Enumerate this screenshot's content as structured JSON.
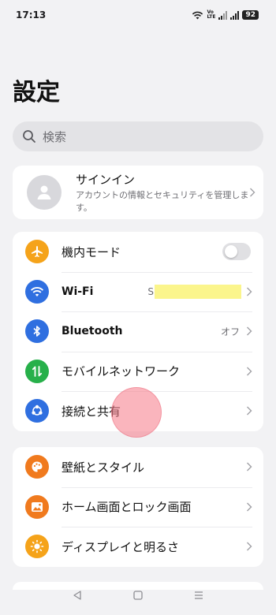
{
  "status_bar": {
    "time": "17:13",
    "volte_top": "Vo",
    "volte_bottom": "LTE",
    "battery": "92"
  },
  "page": {
    "title": "設定"
  },
  "search": {
    "placeholder": "検索"
  },
  "account": {
    "title": "サインイン",
    "subtitle": "アカウントの情報とセキュリティを管理します。"
  },
  "connectivity": {
    "items": [
      {
        "label": "機内モード",
        "icon": "airplane-icon",
        "color": "#f5a31a",
        "control": "toggle",
        "toggle_on": false
      },
      {
        "label": "Wi-Fi",
        "icon": "wifi-icon",
        "color": "#2f6fe0",
        "value": "S"
      },
      {
        "label": "Bluetooth",
        "icon": "bluetooth-icon",
        "color": "#2f6fe0",
        "value": "オフ"
      },
      {
        "label": "モバイルネットワーク",
        "icon": "mobile-network-icon",
        "color": "#27b04a"
      },
      {
        "label": "接続と共有",
        "icon": "connection-sharing-icon",
        "color": "#2f6fe0"
      }
    ]
  },
  "personalization": {
    "items": [
      {
        "label": "壁紙とスタイル",
        "icon": "palette-icon",
        "color": "#f07a1e"
      },
      {
        "label": "ホーム画面とロック画面",
        "icon": "home-lock-screen-icon",
        "color": "#f07a1e"
      },
      {
        "label": "ディスプレイと明るさ",
        "icon": "brightness-icon",
        "color": "#f5a31a"
      }
    ]
  },
  "nav": {
    "back": "back-icon",
    "home": "home-icon",
    "recents": "menu-icon"
  }
}
